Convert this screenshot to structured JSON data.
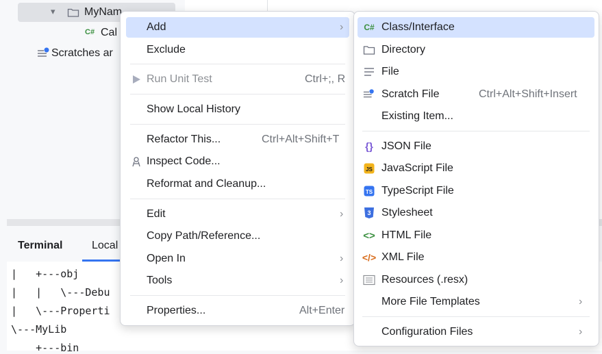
{
  "project_tree": {
    "folder_label": "MyNam",
    "file_label": "Cal",
    "scratches_label": "Scratches ar"
  },
  "bottom_panel": {
    "tabs": [
      "Terminal",
      "Local"
    ],
    "terminal_lines": [
      "|   +---obj",
      "|   |   \\---Debu",
      "|   \\---Properti",
      "\\---MyLib",
      "    +---bin"
    ]
  },
  "context_menu": {
    "items": [
      {
        "label": "Add",
        "submenu": true,
        "highlighted": true
      },
      {
        "label": "Exclude"
      },
      {
        "label": "Run Unit Test",
        "shortcut": "Ctrl+;, R",
        "disabled": true
      },
      {
        "label": "Show Local History"
      },
      {
        "label": "Refactor This...",
        "shortcut": "Ctrl+Alt+Shift+T"
      },
      {
        "label": "Inspect Code..."
      },
      {
        "label": "Reformat and Cleanup..."
      },
      {
        "label": "Edit",
        "submenu": true
      },
      {
        "label": "Copy Path/Reference..."
      },
      {
        "label": "Open In",
        "submenu": true
      },
      {
        "label": "Tools",
        "submenu": true
      },
      {
        "label": "Properties...",
        "shortcut": "Alt+Enter"
      }
    ]
  },
  "add_submenu": {
    "items": [
      {
        "label": "Class/Interface",
        "icon": "csharp-class-icon",
        "highlighted": true
      },
      {
        "label": "Directory",
        "icon": "folder-icon"
      },
      {
        "label": "File",
        "icon": "file-icon"
      },
      {
        "label": "Scratch File",
        "icon": "scratch-file-icon",
        "shortcut": "Ctrl+Alt+Shift+Insert"
      },
      {
        "label": "Existing Item..."
      },
      {
        "label": "JSON File",
        "icon": "json-icon"
      },
      {
        "label": "JavaScript File",
        "icon": "javascript-icon"
      },
      {
        "label": "TypeScript File",
        "icon": "typescript-icon"
      },
      {
        "label": "Stylesheet",
        "icon": "css-icon"
      },
      {
        "label": "HTML File",
        "icon": "html-icon"
      },
      {
        "label": "XML File",
        "icon": "xml-icon"
      },
      {
        "label": "Resources (.resx)",
        "icon": "resx-icon"
      },
      {
        "label": "More File Templates",
        "submenu": true
      },
      {
        "label": "Configuration Files",
        "submenu": true
      }
    ]
  },
  "colors": {
    "highlight": "#d4e2ff",
    "csharp_green": "#3a8f3f",
    "json_purple": "#7b5bd6",
    "js_yellow": "#f2b31b",
    "ts_blue": "#3574f0",
    "css_blue": "#3d6fe0",
    "html_green": "#3a8f3f",
    "xml_orange": "#d86b1a",
    "accent": "#3574f0"
  }
}
